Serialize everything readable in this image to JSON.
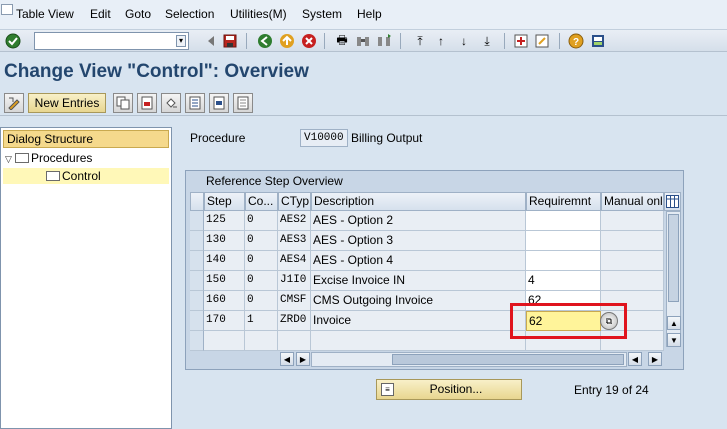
{
  "menu": {
    "items": [
      "Table View",
      "Edit",
      "Goto",
      "Selection",
      "Utilities(M)",
      "System",
      "Help"
    ],
    "underline_first": [
      "T",
      "E",
      "G",
      "S",
      "U",
      "y",
      "H"
    ]
  },
  "toolbar": {
    "command_value": "",
    "icons": [
      "check-icon",
      "back-arrow-icon",
      "save-icon",
      "back-icon",
      "exit-icon",
      "cancel-icon",
      "print-icon",
      "find-icon",
      "find-next-icon",
      "first-page-icon",
      "prev-page-icon",
      "next-page-icon",
      "last-page-icon",
      "layout-icon",
      "create-shortcut-icon",
      "help-icon",
      "customize-icon"
    ]
  },
  "title": "Change View \"Control\": Overview",
  "app_toolbar": {
    "new_entries_label": "New Entries"
  },
  "dialog_structure": {
    "header": "Dialog Structure",
    "items": [
      {
        "label": "Procedures",
        "level": 0,
        "expanded": true
      },
      {
        "label": "Control",
        "level": 1,
        "selected": true
      }
    ]
  },
  "procedure": {
    "label": "Procedure",
    "value": "V10000",
    "description": "Billing Output"
  },
  "table": {
    "title": "Reference Step Overview",
    "columns": [
      "Step",
      "Co...",
      "CTyp",
      "Description",
      "Requiremnt",
      "Manual onl"
    ],
    "rows": [
      {
        "step": "125",
        "counter": "0",
        "ctyp": "AES2",
        "description": "AES - Option 2",
        "requirement": ""
      },
      {
        "step": "130",
        "counter": "0",
        "ctyp": "AES3",
        "description": "AES - Option 3",
        "requirement": ""
      },
      {
        "step": "140",
        "counter": "0",
        "ctyp": "AES4",
        "description": "AES - Option 4",
        "requirement": ""
      },
      {
        "step": "150",
        "counter": "0",
        "ctyp": "J1I0",
        "description": "Excise Invoice IN",
        "requirement": "4"
      },
      {
        "step": "160",
        "counter": "0",
        "ctyp": "CMSF",
        "description": "CMS Outgoing Invoice",
        "requirement": "62"
      },
      {
        "step": "170",
        "counter": "1",
        "ctyp": "ZRD0",
        "description": "Invoice",
        "requirement": "62"
      }
    ]
  },
  "footer": {
    "position_label": "Position...",
    "entry_text": "Entry 19 of 24"
  }
}
